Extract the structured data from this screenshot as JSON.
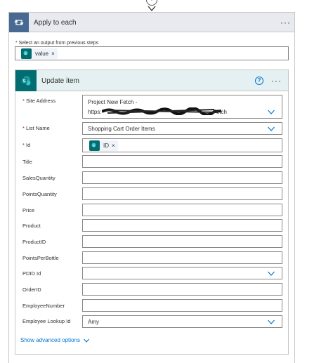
{
  "connector": {
    "plus_icon": "plus-icon",
    "arrow_icon": "arrow-down-icon"
  },
  "loop": {
    "title": "Apply to each",
    "more": "···",
    "select_label": "Select an output from previous steps",
    "token_label": "value",
    "token_remove": "×"
  },
  "action": {
    "title": "Update item",
    "help": "?",
    "more": "···",
    "fields": {
      "site_address": {
        "label": "Site Address",
        "line1": "Project New Fetch -",
        "line2": "https:",
        "line2_tail": "Fetch"
      },
      "list_name": {
        "label": "List Name",
        "value": "Shopping Cart Order Items"
      },
      "id": {
        "label": "Id",
        "token_label": "ID",
        "token_remove": "×"
      },
      "title": {
        "label": "Title"
      },
      "sales_quantity": {
        "label": "SalesQuantity"
      },
      "points_quantity": {
        "label": "PointsQuantity"
      },
      "price": {
        "label": "Price"
      },
      "product": {
        "label": "Product"
      },
      "product_id": {
        "label": "ProductID"
      },
      "points_per_bottle": {
        "label": "PointsPerBottle"
      },
      "pdid_id": {
        "label": "PDID Id"
      },
      "order_id": {
        "label": "OrderID"
      },
      "employee_number": {
        "label": "EmployeeNumber"
      },
      "employee_lookup_id": {
        "label": "Employee Lookup Id",
        "value": "Amy"
      }
    },
    "show_advanced": "Show advanced options"
  },
  "colors": {
    "loop_accent": "#486991",
    "sharepoint_accent": "#036c70",
    "link": "#0078d4",
    "required": "#a4262c"
  }
}
